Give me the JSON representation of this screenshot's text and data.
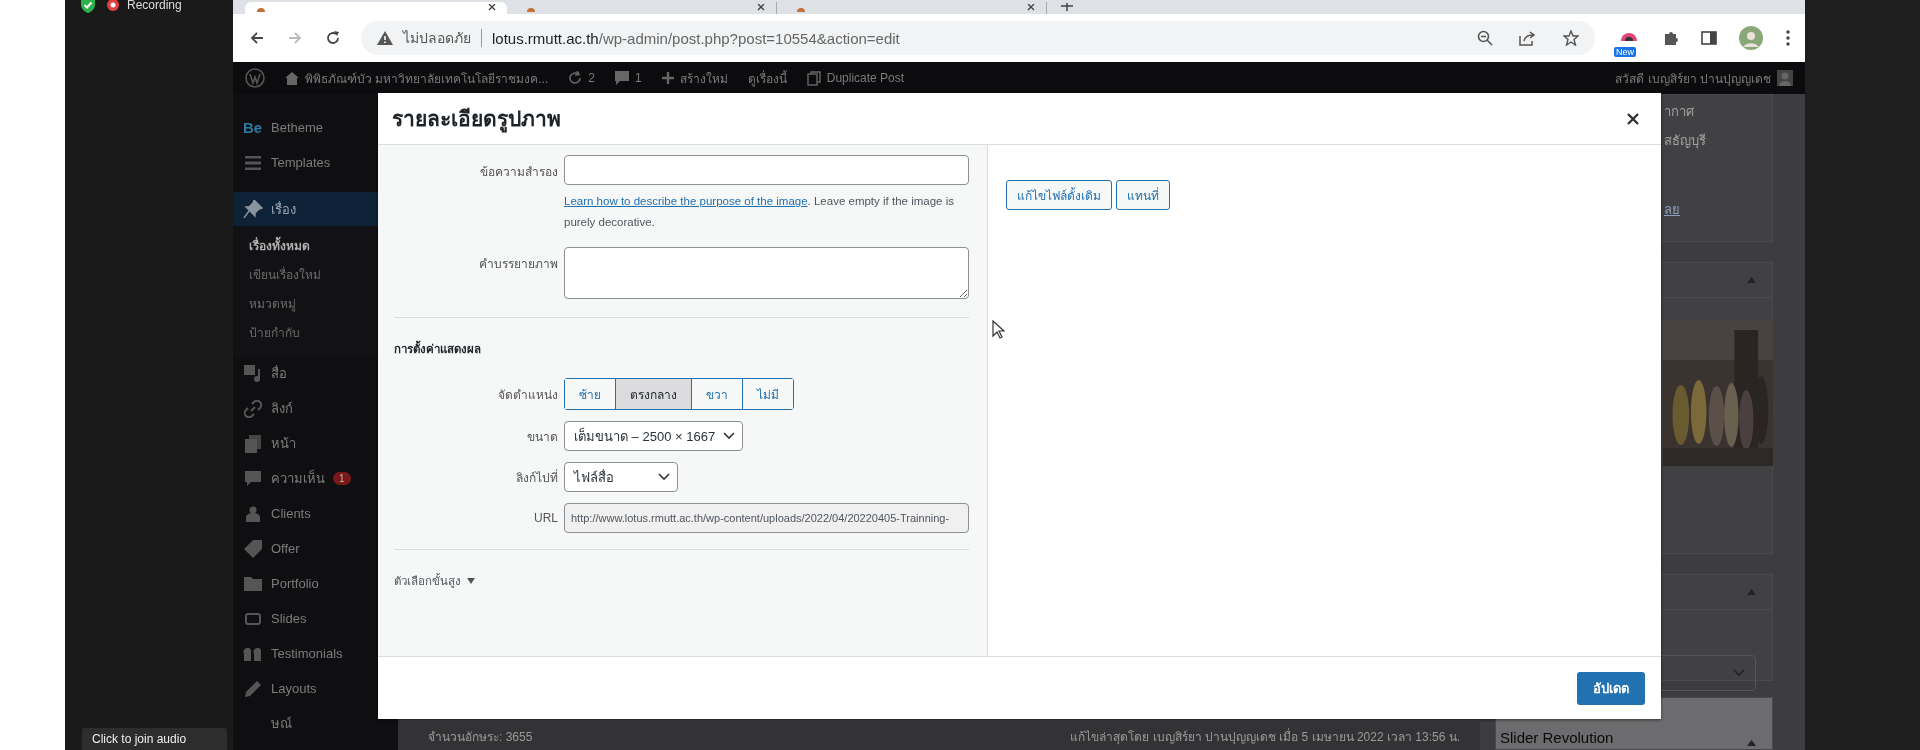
{
  "recorder": {
    "status": "Recording",
    "caption": "Click to join audio"
  },
  "browser": {
    "tabs": [
      {
        "selected": true
      },
      {
        "selected": false
      },
      {
        "selected": false
      }
    ],
    "address_bar": {
      "security": "ไม่ปลอดภัย",
      "host": "lotus.rmutt.ac.th",
      "path": "/wp-admin/post.php?post=10554&action=edit"
    },
    "extension_badge": "New"
  },
  "admin_bar": {
    "site": "พิพิธภัณฑ์บัว มหาวิทยาลัยเทคโนโลยีราชมงค...",
    "updates": "2",
    "comments": "1",
    "new": "สร้างใหม่",
    "view": "ดูเรื่องนี้",
    "duplicate": "Duplicate Post",
    "greeting": "สวัสดี เบญสิร์ยา ปานปุญญเดช"
  },
  "sidebar": {
    "items": [
      {
        "label": "Betheme",
        "logo": "Be",
        "selected": false
      },
      {
        "label": "Templates",
        "selected": false
      },
      {
        "label": "เรื่อง",
        "selected": true,
        "children": [
          {
            "label": "เรื่องทั้งหมด",
            "selected": true
          },
          {
            "label": "เขียนเรื่องใหม่",
            "selected": false
          },
          {
            "label": "หมวดหมู่",
            "selected": false
          },
          {
            "label": "ป้ายกำกับ",
            "selected": false
          }
        ]
      },
      {
        "label": "สื่อ",
        "selected": false
      },
      {
        "label": "ลิงก์",
        "selected": false
      },
      {
        "label": "หน้า",
        "selected": false
      },
      {
        "label": "ความเห็น",
        "badge": "1",
        "selected": false
      },
      {
        "label": "Clients",
        "selected": false
      },
      {
        "label": "Offer",
        "selected": false
      },
      {
        "label": "Portfolio",
        "selected": false
      },
      {
        "label": "Slides",
        "selected": false
      },
      {
        "label": "Testimonials",
        "selected": false
      },
      {
        "label": "Layouts",
        "selected": false
      },
      {
        "label": "ษณ์",
        "selected": false
      }
    ]
  },
  "modal": {
    "title": "รายละเอียดรูปภาพ",
    "alt_text": {
      "label": "ข้อความสำรอง"
    },
    "help_link": "Learn how to describe the purpose of the image",
    "help_text": ". Leave empty if the image is purely decorative.",
    "caption": {
      "label": "คำบรรยายภาพ"
    },
    "display_heading": "การตั้งค่าแสดงผล",
    "alignment": {
      "label": "จัดตำแหน่ง",
      "options": [
        {
          "label": "ซ้าย",
          "selected": false
        },
        {
          "label": "ตรงกลาง",
          "selected": true
        },
        {
          "label": "ขวา",
          "selected": false
        },
        {
          "label": "ไม่มี",
          "selected": false
        }
      ]
    },
    "size": {
      "label": "ขนาด",
      "value": "เต็มขนาด – 2500 × 1667"
    },
    "link_to": {
      "label": "ลิงก์ไปที่",
      "value": "ไฟล์สื่อ"
    },
    "url": {
      "label": "URL",
      "value": "http://www.lotus.rmutt.ac.th/wp-content/uploads/2022/04/20220405-Trainning-"
    },
    "advanced": "ตัวเลือกขั้นสูง",
    "actions": [
      "แก้ไขไฟล์ดั้งเดิม",
      "แทนที่"
    ],
    "submit": "อัปเดต"
  },
  "background": {
    "fragments": [
      "ากาศ",
      "สธัญบุรี"
    ],
    "fragment_link": "ลย",
    "box_title": "Slider Revolution",
    "word_count": "จำนวนอักษระ: 3655",
    "last_edited": "แก้ไขล่าสุดโดย เบญสิร์ยา ปานปุญญเดช เมื่อ 5 เมษายน 2022 เวลา 13:56 น."
  }
}
